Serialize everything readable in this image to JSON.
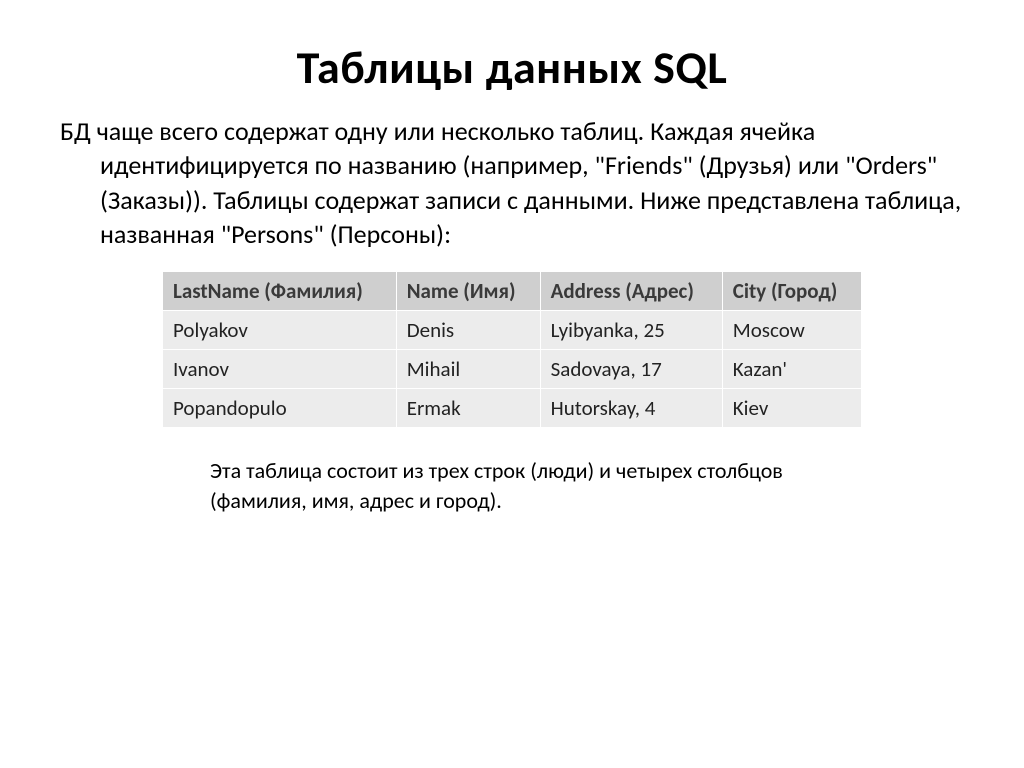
{
  "title": "Таблицы данных SQL",
  "body": "БД чаще всего содержат одну или несколько таблиц. Каждая ячейка идентифицируется по названию (например, \"Friends\" (Друзья) или \"Orders\" (Заказы)). Таблицы содержат записи с данными. Ниже представлена таблица, названная \"Persons\" (Персоны):",
  "table": {
    "headers": [
      "LastName (Фамилия)",
      "Name (Имя)",
      "Address (Адрес)",
      "City (Город)"
    ],
    "rows": [
      [
        "Polyakov",
        "Denis",
        "Lyibyanka, 25",
        "Moscow"
      ],
      [
        "Ivanov",
        "Mihail",
        "Sadovaya, 17",
        "Kazan'"
      ],
      [
        "Popandopulo",
        "Ermak",
        "Hutorskay, 4",
        "Kiev"
      ]
    ]
  },
  "footnote": "Эта таблица состоит из трех строк (люди) и четырех столбцов (фамилия, имя, адрес и город)."
}
